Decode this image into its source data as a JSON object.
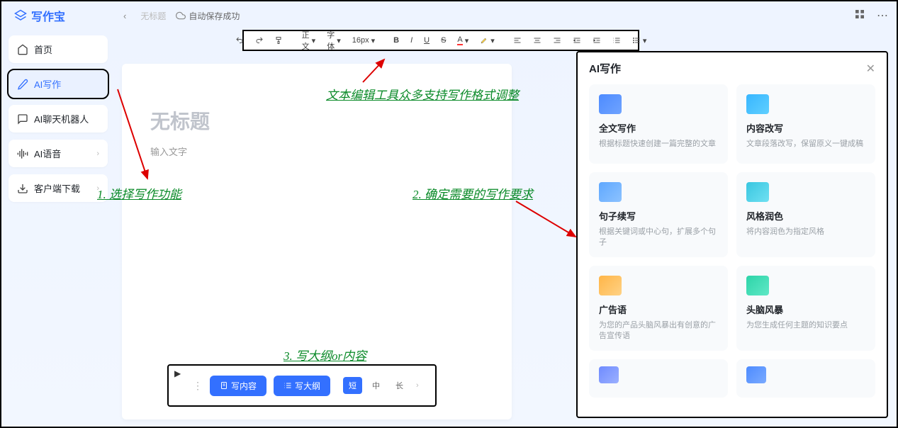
{
  "app": {
    "name": "写作宝"
  },
  "topbar": {
    "back_label": "‹",
    "untitled": "无标题",
    "autosave": "自动保存成功"
  },
  "sidebar": {
    "items": [
      {
        "label": "首页",
        "icon": "home"
      },
      {
        "label": "AI写作",
        "icon": "pen",
        "active": true
      },
      {
        "label": "AI聊天机器人",
        "icon": "chat"
      },
      {
        "label": "AI语音",
        "icon": "voice",
        "chevron": true
      },
      {
        "label": "客户端下载",
        "icon": "download",
        "chevron": true
      }
    ]
  },
  "toolbar": {
    "text_style": "正文",
    "font_family": "字体",
    "font_size": "16px"
  },
  "editor": {
    "title_placeholder": "无标题",
    "body_placeholder": "输入文字"
  },
  "bottom": {
    "write_content": "写内容",
    "write_outline": "写大纲",
    "length": {
      "short": "短",
      "medium": "中",
      "long": "长",
      "active": "短"
    }
  },
  "ai_panel": {
    "title": "AI写作",
    "cards": [
      {
        "title": "全文写作",
        "desc": "根据标题快速创建一篇完整的文章",
        "color": "#4d8bff"
      },
      {
        "title": "内容改写",
        "desc": "文章段落改写，保留原义一键成稿",
        "color": "#38b6ff"
      },
      {
        "title": "句子续写",
        "desc": "根据关键词或中心句，扩展多个句子",
        "color": "#5fa8ff"
      },
      {
        "title": "风格润色",
        "desc": "将内容润色为指定风格",
        "color": "#39c6e0"
      },
      {
        "title": "广告语",
        "desc": "为您的产品头脑风暴出有创意的广告宣传语",
        "color": "#ffb547"
      },
      {
        "title": "头脑风暴",
        "desc": "为您生成任何主题的知识要点",
        "color": "#2dd4a8"
      }
    ],
    "partial_colors": [
      "#6f8bff",
      "#4d8bff"
    ]
  },
  "annotations": {
    "a1": "1. 选择写作功能",
    "a2": "文本编辑工具众多支持写作格式调整",
    "a3": "2. 确定需要的写作要求",
    "a4": "3. 写大纲or内容"
  }
}
